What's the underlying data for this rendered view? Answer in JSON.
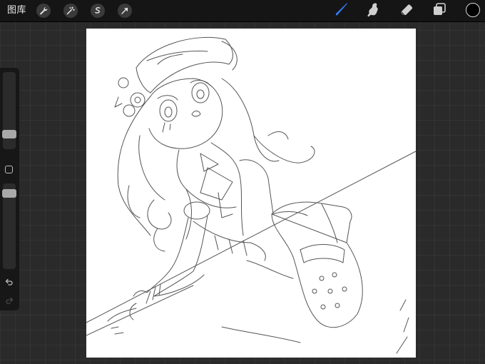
{
  "app": {
    "gallery_label": "图库"
  },
  "toolbar": {
    "left_tools": [
      {
        "name": "actions",
        "icon": "wrench-icon"
      },
      {
        "name": "adjustments",
        "icon": "magic-wand-icon"
      },
      {
        "name": "selection",
        "icon": "selection-s-icon"
      },
      {
        "name": "transform",
        "icon": "arrow-cursor-icon"
      }
    ],
    "right_tools": [
      {
        "name": "brush",
        "icon": "brush-icon",
        "active": true,
        "color": "#2f7bf5"
      },
      {
        "name": "smudge",
        "icon": "smudge-finger-icon",
        "active": false
      },
      {
        "name": "eraser",
        "icon": "eraser-icon",
        "active": false
      },
      {
        "name": "layers",
        "icon": "layers-icon",
        "active": false
      }
    ],
    "current_color": "#000000"
  },
  "sidebar": {
    "brush_size_level": 0.8,
    "opacity_level": 0.05,
    "undo_icon": "undo-icon",
    "redo_icon": "redo-icon"
  },
  "canvas": {
    "background": "#ffffff",
    "line_color": "#555555",
    "content": "line-art sketch"
  }
}
